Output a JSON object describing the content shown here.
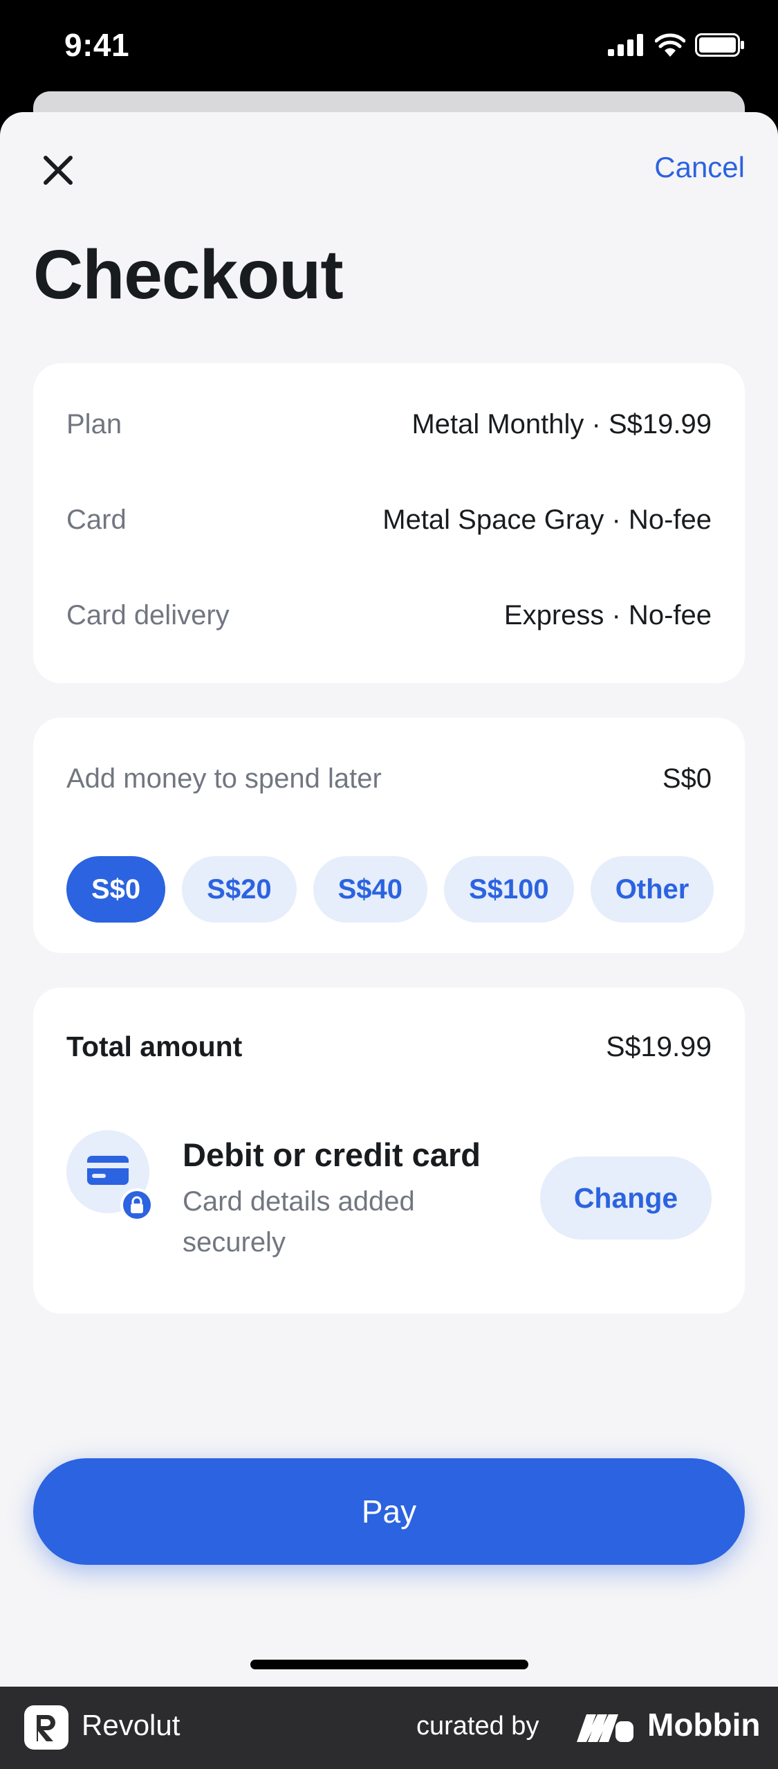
{
  "status_bar": {
    "time": "9:41"
  },
  "header": {
    "cancel_label": "Cancel",
    "title": "Checkout"
  },
  "summary": {
    "rows": [
      {
        "label": "Plan",
        "value": "Metal Monthly · S$19.99"
      },
      {
        "label": "Card",
        "value": "Metal Space Gray · No-fee"
      },
      {
        "label": "Card delivery",
        "value": "Express · No-fee"
      }
    ]
  },
  "top_up": {
    "label": "Add money to spend later",
    "amount": "S$0",
    "options": [
      "S$0",
      "S$20",
      "S$40",
      "S$100",
      "Other"
    ],
    "selected": "S$0"
  },
  "payment": {
    "total_label": "Total amount",
    "total_value": "S$19.99",
    "method_title": "Debit or credit card",
    "method_subtitle": "Card details added securely",
    "change_label": "Change"
  },
  "pay_label": "Pay",
  "footer": {
    "app_name": "Revolut",
    "curated_by": "curated by",
    "brand": "Mobbin"
  },
  "colors": {
    "accent": "#2b63e0",
    "accent_light": "#e6edfb",
    "background": "#f5f5f7"
  }
}
